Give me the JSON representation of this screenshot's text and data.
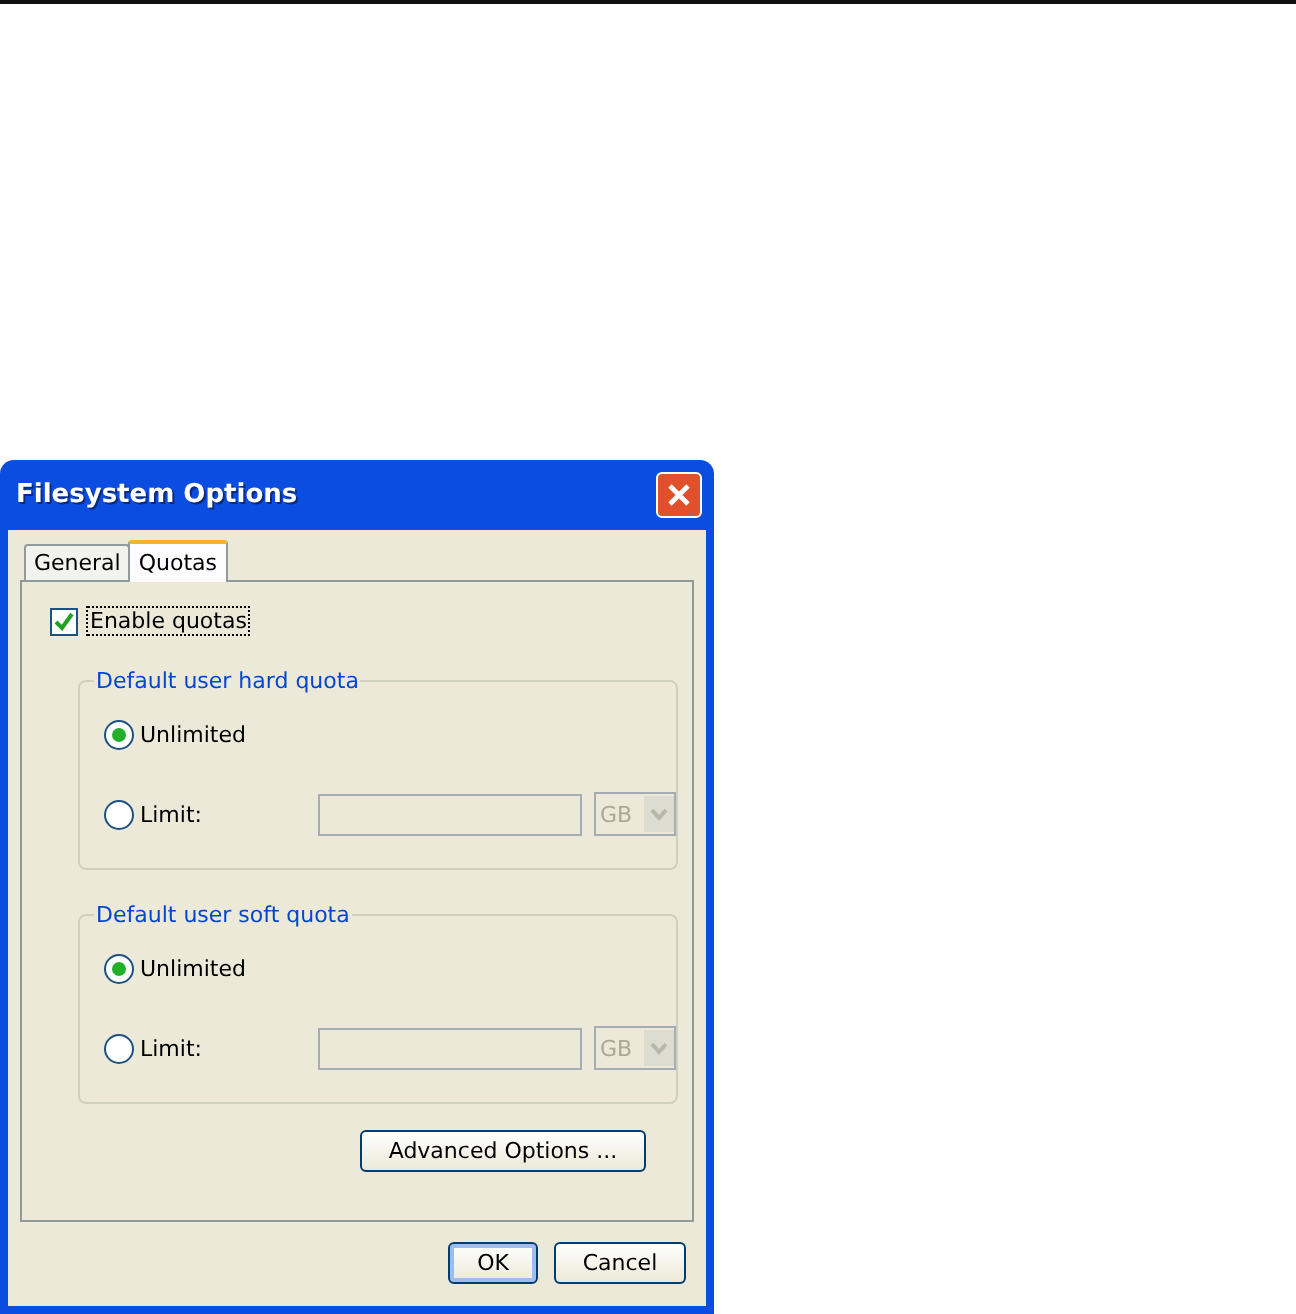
{
  "window": {
    "title": "Filesystem Options"
  },
  "tabs": [
    {
      "label": "General",
      "selected": false
    },
    {
      "label": "Quotas",
      "selected": true
    }
  ],
  "enable_quotas": {
    "label": "Enable quotas",
    "checked": true
  },
  "groups": [
    {
      "title": "Default user hard quota",
      "options": [
        {
          "label": "Unlimited",
          "selected": true
        },
        {
          "label": "Limit:",
          "selected": false
        }
      ],
      "unit": "GB",
      "disabled": true
    },
    {
      "title": "Default user soft quota",
      "options": [
        {
          "label": "Unlimited",
          "selected": true
        },
        {
          "label": "Limit:",
          "selected": false
        }
      ],
      "unit": "GB",
      "disabled": true
    }
  ],
  "advanced_button": "Advanced Options ...",
  "buttons": [
    {
      "label": "OK",
      "kind": "default"
    },
    {
      "label": "Cancel",
      "kind": "normal"
    }
  ]
}
